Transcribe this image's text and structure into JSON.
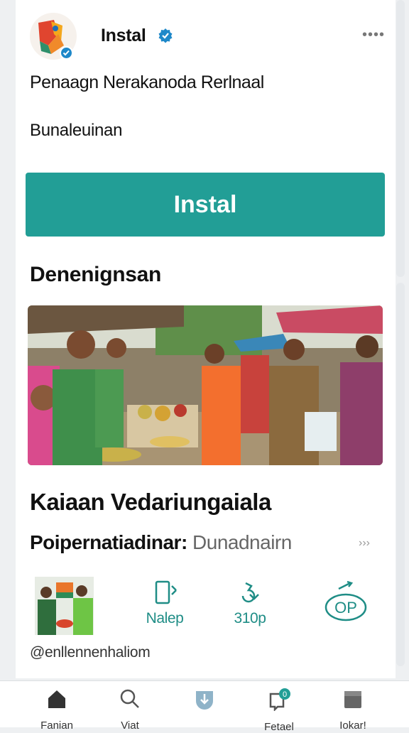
{
  "app": {
    "name": "Instal",
    "subtitle": "Penaagn Nerakanoda Rerlnaal",
    "category": "Bunaleuinan"
  },
  "install_button": {
    "label": "Instal"
  },
  "section": {
    "title": "Denenignsan"
  },
  "feature": {
    "title": "Kaiaan Vedariungaiala",
    "label_bold": "Poipernatiadinar:",
    "label_light": "Dunadnairn"
  },
  "stats": [
    {
      "label": "Nalep",
      "icon": "phone-icon"
    },
    {
      "label": "310p",
      "icon": "download-icon"
    },
    {
      "label": "",
      "badge": "OP",
      "icon": "age-rating-icon"
    }
  ],
  "developer": {
    "handle": "@enllennenhaliom"
  },
  "nav": {
    "items": [
      {
        "label": "Fanian",
        "icon": "home-icon"
      },
      {
        "label": "Viat",
        "icon": "search-icon"
      },
      {
        "label": "",
        "icon": "download-shield-icon"
      },
      {
        "label": "Fetael",
        "icon": "notification-icon",
        "badge": "0"
      },
      {
        "label": "Iokar!",
        "icon": "library-icon"
      }
    ]
  },
  "colors": {
    "accent": "#229e96",
    "verified": "#1e88c9"
  }
}
